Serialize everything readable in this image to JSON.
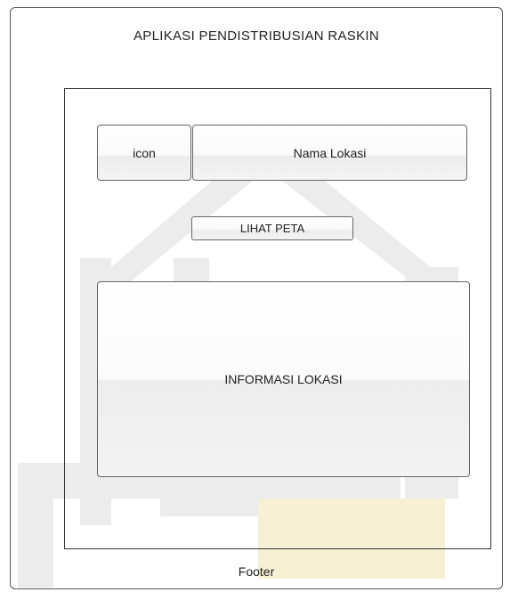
{
  "app": {
    "title": "APLIKASI PENDISTRIBUSIAN RASKIN"
  },
  "location": {
    "icon_placeholder": "icon",
    "name_placeholder": "Nama Lokasi"
  },
  "actions": {
    "view_map_label": "LIHAT PETA"
  },
  "info": {
    "label": "INFORMASI LOKASI"
  },
  "footer": {
    "label": "Footer"
  },
  "colors": {
    "frame": "#555555",
    "watermark": "#e9e9e9",
    "watermark_accent": "#f4eed2"
  }
}
